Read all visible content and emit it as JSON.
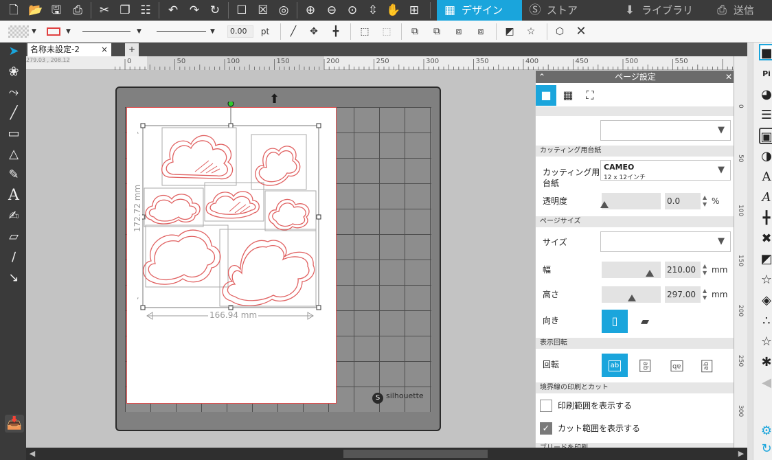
{
  "toolbar_top": {
    "tabs": [
      {
        "label": "デザイン",
        "icon": "grid-icon",
        "active": true
      },
      {
        "label": "ストア",
        "icon": "store-icon",
        "active": false
      },
      {
        "label": "ライブラリ",
        "icon": "library-download-icon",
        "active": false
      },
      {
        "label": "送信",
        "icon": "cutter-send-icon",
        "active": false
      }
    ],
    "accent_color": "#1aa5dc"
  },
  "toolbar_line": {
    "line_width_value": "0.00",
    "line_width_unit": "pt"
  },
  "document": {
    "tab_title": "名称未設定-2",
    "tab_close": "×",
    "add_tab": "+"
  },
  "ruler": {
    "coord_readout": "279.03 , 208.12",
    "top_labels": [
      "0",
      "50",
      "100",
      "150",
      "200",
      "250",
      "300",
      "350",
      "400",
      "450",
      "500",
      "550"
    ],
    "side_labels": [
      "0",
      "50",
      "100",
      "150",
      "200",
      "250",
      "300"
    ]
  },
  "canvas": {
    "width_dimension": "166.94 mm",
    "height_dimension": "172.72 mm",
    "brand": "silhouette"
  },
  "panel": {
    "title": "ページ設定",
    "sections": {
      "cutting_mat": "カッティング用台紙",
      "page_size": "ページサイズ",
      "view_rotation": "表示回転",
      "registration": "境界線の印刷とカット",
      "bleed": "ブリードを印刷"
    },
    "mat_label": "カッティング用台紙",
    "mat_value": "CAMEO",
    "mat_sub": "12 x 12インチ",
    "transparency_label": "透明度",
    "transparency_value": "0.0",
    "transparency_unit": "%",
    "size_label": "サイズ",
    "width_label": "幅",
    "width_value": "210.00",
    "height_label": "高さ",
    "height_value": "297.00",
    "length_unit": "mm",
    "orientation_label": "向き",
    "rotation_label": "回転",
    "show_print_area": "印刷範囲を表示する",
    "show_print_area_checked": false,
    "show_cut_area": "カット範囲を表示する",
    "show_cut_area_checked": true
  }
}
